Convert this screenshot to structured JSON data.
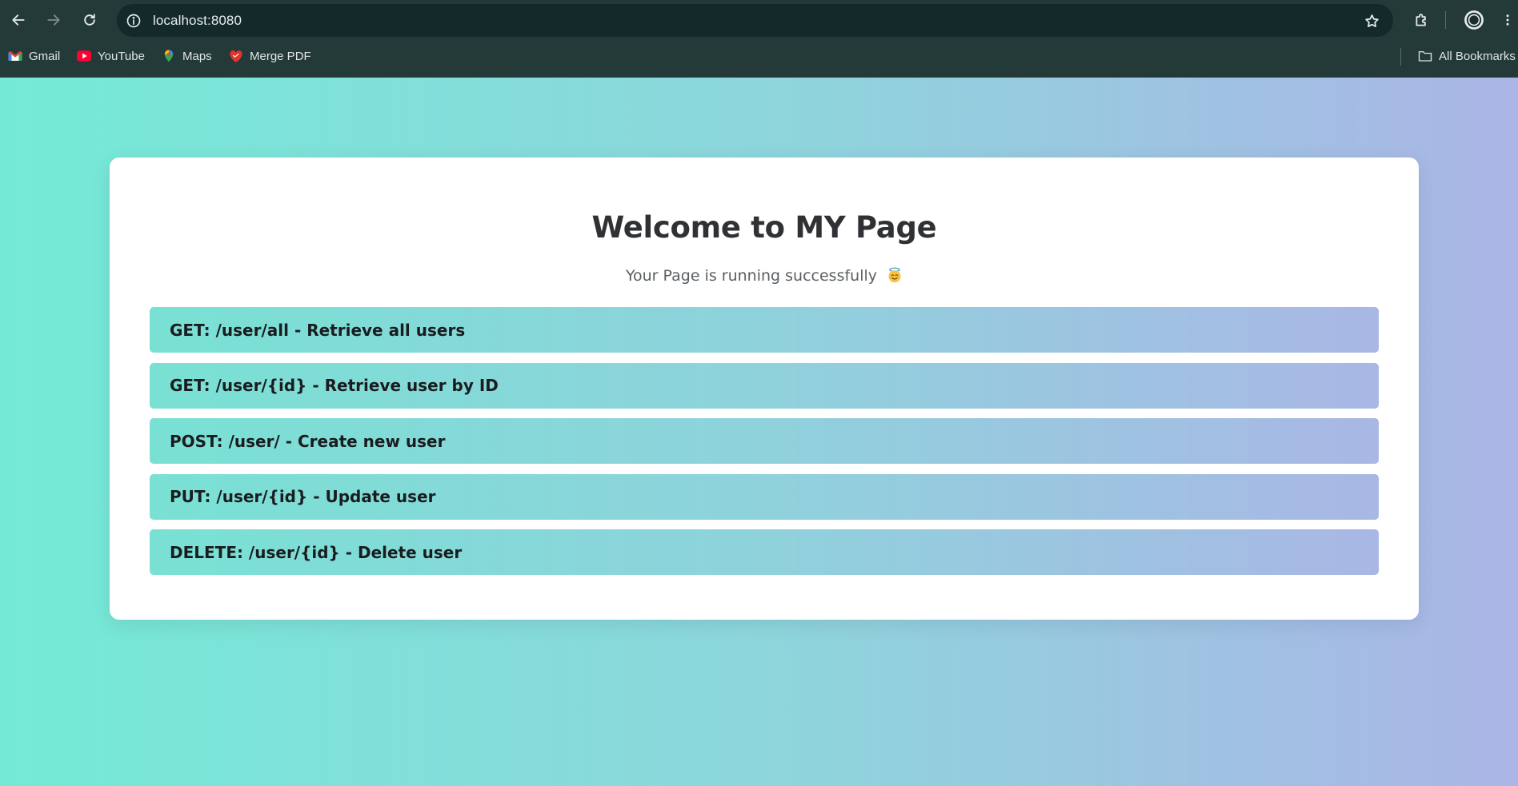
{
  "browser": {
    "url": "localhost:8080",
    "bookmarks": [
      {
        "label": "Gmail",
        "icon": "gmail-icon"
      },
      {
        "label": "YouTube",
        "icon": "youtube-icon"
      },
      {
        "label": "Maps",
        "icon": "maps-icon"
      },
      {
        "label": "Merge PDF",
        "icon": "heart-icon"
      }
    ],
    "all_bookmarks_label": "All Bookmarks"
  },
  "page": {
    "title": "Welcome to MY Page",
    "subtitle": "Your Page is running successfully",
    "subtitle_emoji": "smiling-face-with-halo-icon",
    "endpoints": [
      {
        "label": "GET: /user/all - Retrieve all users"
      },
      {
        "label": "GET: /user/{id} - Retrieve user by ID"
      },
      {
        "label": "POST: /user/ - Create new user"
      },
      {
        "label": "PUT: /user/{id} - Update user"
      },
      {
        "label": "DELETE: /user/{id} - Delete user"
      }
    ]
  },
  "colors": {
    "gradient_start": "#74ead6",
    "gradient_end": "#abb5e6",
    "chrome_bg": "#243a39",
    "omnibox_bg": "#13292a"
  }
}
